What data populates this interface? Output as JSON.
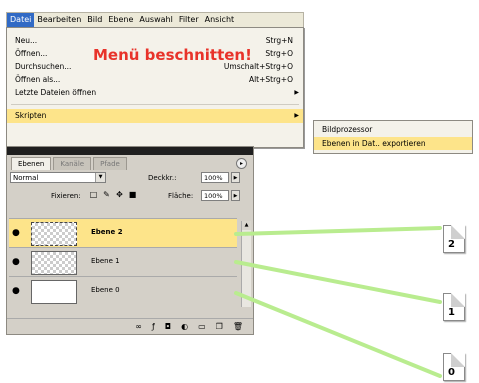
{
  "menubar": {
    "items": [
      "Datei",
      "Bearbeiten",
      "Bild",
      "Ebene",
      "Auswahl",
      "Filter",
      "Ansicht"
    ],
    "active": "Datei"
  },
  "file_menu": {
    "overlay_text": "Menü beschnitten!",
    "items": [
      {
        "label": "Neu...",
        "shortcut": "Strg+N"
      },
      {
        "label": "Öffnen...",
        "shortcut": "Strg+O"
      },
      {
        "label": "Durchsuchen...",
        "shortcut": "Umschalt+Strg+O"
      },
      {
        "label": "Öffnen als...",
        "shortcut": "Alt+Strg+O"
      },
      {
        "label": "Letzte Dateien öffnen",
        "shortcut": ""
      },
      {
        "label": "Skripten",
        "shortcut": ""
      }
    ]
  },
  "submenu": {
    "items": [
      "Bildprozessor",
      "Ebenen in Dat.. exportieren"
    ]
  },
  "layers_panel": {
    "tabs": [
      "Ebenen",
      "Kanäle",
      "Pfade"
    ],
    "blend_mode": "Normal",
    "opacity_label": "Deckkr.:",
    "opacity_value": "100%",
    "lock_label": "Fixieren:",
    "fill_label": "Fläche:",
    "fill_value": "100%",
    "layers": [
      {
        "name": "Ebene 2",
        "selected": true
      },
      {
        "name": "Ebene 1",
        "selected": false
      },
      {
        "name": "Ebene 0",
        "selected": false
      }
    ]
  },
  "export_files": [
    "2",
    "1",
    "0"
  ],
  "colors": {
    "highlight": "#fde48a",
    "overlay_text": "#e8332a",
    "connector": "#b9ec8f"
  }
}
